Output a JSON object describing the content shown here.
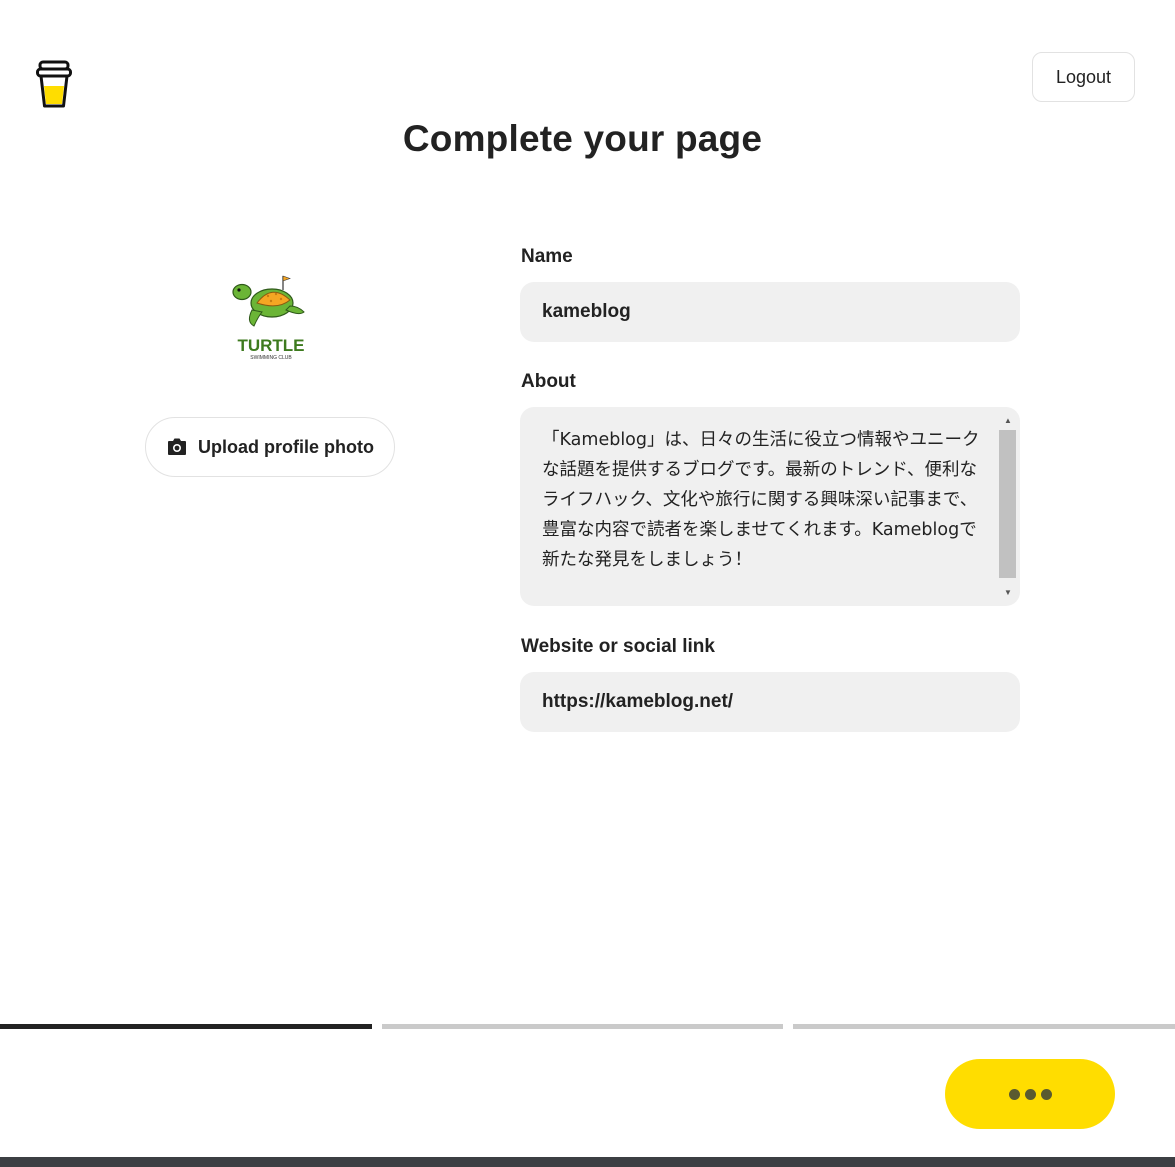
{
  "header": {
    "logo_icon": "coffee-cup-icon",
    "logout_label": "Logout"
  },
  "page": {
    "title": "Complete your page"
  },
  "profile": {
    "avatar_title": "TURTLE",
    "avatar_subtitle": "SWIMMING CLUB",
    "upload_label": "Upload profile photo",
    "upload_icon": "camera-icon"
  },
  "form": {
    "name_label": "Name",
    "name_value": "kameblog",
    "about_label": "About",
    "about_value": "「Kameblog」は、日々の生活に役立つ情報やユニークな話題を提供するブログです。最新のトレンド、便利なライフハック、文化や旅行に関する興味深い記事まで、豊富な内容で読者を楽しませてくれます。Kameblogで新たな発見をしましょう！",
    "website_label": "Website or social link",
    "website_value": "https://kameblog.net/"
  },
  "progress": {
    "current_step": 1,
    "total_steps": 3
  },
  "footer": {
    "next_icon": "ellipsis-icon"
  },
  "colors": {
    "accent": "#ffdd00",
    "progress_active": "#222222",
    "progress_inactive": "#cacaca",
    "input_bg": "#f0f0f0"
  }
}
